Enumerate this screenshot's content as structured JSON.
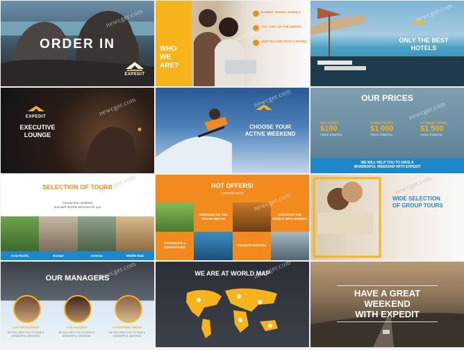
{
  "watermark": "newcger.com",
  "tiles": {
    "t1": {
      "title": "ORDER IN",
      "logo_text": "EXPEDIT"
    },
    "t2": {
      "title_lines": [
        "WHO",
        "WE",
        "ARE?"
      ],
      "items": [
        "EXPERT TRAVEL AGENCY",
        "THE PART OF THE UNWTO",
        "JUST IN LOVE WITH A TRAVEL"
      ]
    },
    "t3": {
      "title_lines": [
        "ONLY THE BEST",
        "HOTELS"
      ],
      "logo_text": "EXPEDIT"
    },
    "t4": {
      "title_lines": [
        "EXECUTIVE",
        "LOUNGE"
      ],
      "logo_text": "EXPEDIT"
    },
    "t5": {
      "title_lines": [
        "CHOOSE YOUR",
        "ACTIVE WEEKEND"
      ],
      "logo_text": "EXPEDIT"
    },
    "t6": {
      "title": "OUR PRICES",
      "prices": [
        {
          "label": "BUS TOURS",
          "value": "$100",
          "sub": "PRICE STARTED"
        },
        {
          "label": "FAMILY TOURS",
          "value": "$1 000",
          "sub": "PRICE STARTED"
        },
        {
          "label": "EXTREME TOURS",
          "value": "$1 500",
          "sub": "PRICE STARTED"
        }
      ],
      "footer_lines": [
        "WE WILL HELP YOU TO HAVE A",
        "WONDERFUL WEEKEND WITH EXPEDIT"
      ]
    },
    "t7": {
      "title": "SELECTION OF TOURS",
      "subtitle_lines": [
        "Choose the continent",
        "and we'll find the best tour for you"
      ],
      "destinations": [
        "Asia-Pacific",
        "Europe",
        "America",
        "Middle East"
      ]
    },
    "t8": {
      "title": "HOT OFFERS!",
      "subtitle": "CHOOSE NOW",
      "offers": [
        "WEEKEND ON THE OCEAN BEACH",
        "DISCOVER THE WORLD WITH EXPEDIT",
        "INTERSHIPS & EXPEDITIONS",
        "WILDLIFE SAFARIS"
      ]
    },
    "t9": {
      "title_lines": [
        "WIDE SELECTION",
        "OF GROUP TOURS"
      ]
    },
    "t10": {
      "title": "OUR MANAGERS",
      "managers": [
        "LISA NICKLESON",
        "ANA HOLDEN",
        "KATHERINE SMITH"
      ],
      "caption_lines": [
        "WE WILL HELP YOU TO HAVE A",
        "WONDERFUL WEEKEND"
      ]
    },
    "t11": {
      "title": "WE ARE AT WORLD MAP"
    },
    "t12": {
      "title_lines": [
        "HAVE A GREAT",
        "WEEKEND",
        "WITH EXPEDIT"
      ]
    }
  },
  "colors": {
    "accent": "#f6b31b",
    "orange": "#f28a1d",
    "blue": "#1f86c8",
    "dark": "#1c1e24"
  }
}
